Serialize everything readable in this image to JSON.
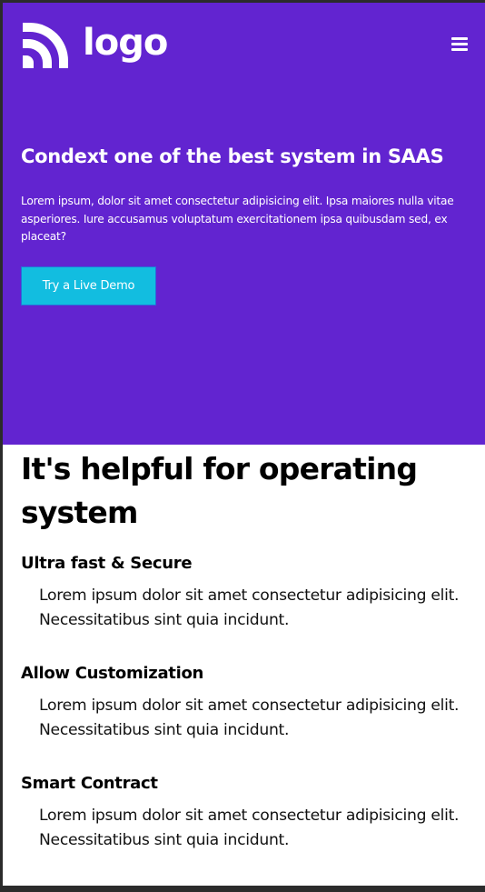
{
  "header": {
    "logo_text": "logo",
    "menu_icon": "hamburger-menu-icon"
  },
  "hero": {
    "title": "Condext one of the best system in SAAS",
    "description": "Lorem ipsum, dolor sit amet consectetur adipisicing elit. Ipsa maiores nulla vitae asperiores. Iure accusamus voluptatum exercitationem ipsa quibusdam sed, ex placeat?",
    "cta_label": "Try a Live Demo"
  },
  "features_section": {
    "title": "It's helpful for operating system",
    "items": [
      {
        "title": "Ultra fast & Secure",
        "text": "Lorem ipsum dolor sit amet consectetur adipisicing elit. Necessitatibus sint quia incidunt."
      },
      {
        "title": "Allow Customization",
        "text": "Lorem ipsum dolor sit amet consectetur adipisicing elit. Necessitatibus sint quia incidunt."
      },
      {
        "title": "Smart Contract",
        "text": "Lorem ipsum dolor sit amet consectetur adipisicing elit. Necessitatibus sint quia incidunt."
      }
    ]
  },
  "colors": {
    "hero_bg": "#6224d0",
    "button_bg": "#12bde0",
    "text_light": "#ffffff",
    "text_dark": "#000000"
  }
}
